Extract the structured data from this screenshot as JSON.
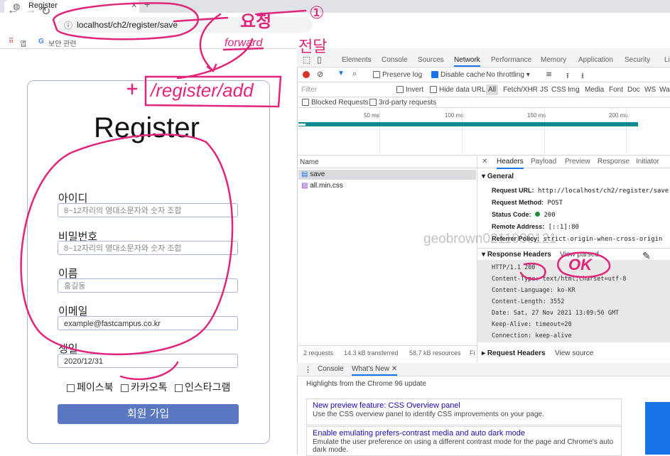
{
  "browser": {
    "tab_title": "Register",
    "tab_icon": "globe-icon",
    "address": "localhost/ch2/register/save",
    "bookmarks": [
      "앱",
      "보안 관련"
    ]
  },
  "form": {
    "title": "Register",
    "fields": [
      {
        "label": "아이디",
        "placeholder": "8~12자리의 영대소문자와 숫자 조합"
      },
      {
        "label": "비밀번호",
        "placeholder": "8~12자리의 영대소문자와 숫자 조합"
      },
      {
        "label": "이름",
        "placeholder": "홍길동"
      },
      {
        "label": "이메일",
        "value": "example@fastcampus.co.kr"
      },
      {
        "label": "생일",
        "value": "2020/12/31"
      }
    ],
    "checkboxes": [
      "페이스북",
      "카카오톡",
      "인스타그램"
    ],
    "submit_label": "회원 가입",
    "accent_color": "#5a78c2"
  },
  "devtools": {
    "tabs": [
      "Elements",
      "Console",
      "Sources",
      "Network",
      "Performance",
      "Memory",
      "Application",
      "Security",
      "Li"
    ],
    "active_tab": "Network",
    "toolbar": {
      "preserve_log": "Preserve log",
      "disable_cache": "Disable cache",
      "throttling": "No throttling"
    },
    "filter": {
      "placeholder": "Filter",
      "invert": "Invert",
      "hide_data_urls": "Hide data URLs",
      "types": [
        "All",
        "Fetch/XHR",
        "JS",
        "CSS",
        "Img",
        "Media",
        "Font",
        "Doc",
        "WS",
        "Was"
      ],
      "blocked": "Blocked Requests",
      "third_party": "3rd-party requests"
    },
    "timeline_ticks": [
      "50 ms",
      "100 ms",
      "150 ms",
      "200 ms"
    ],
    "name_header": "Name",
    "requests": [
      {
        "name": "save",
        "selected": true
      },
      {
        "name": "all.min.css",
        "selected": false
      }
    ],
    "detail_tabs": [
      "Headers",
      "Payload",
      "Preview",
      "Response",
      "Initiator"
    ],
    "general": {
      "title": "General",
      "rows": [
        {
          "key": "Request URL:",
          "value": "http://localhost/ch2/register/save"
        },
        {
          "key": "Request Method:",
          "value": "POST"
        },
        {
          "key": "Status Code:",
          "value": "200"
        },
        {
          "key": "Remote Address:",
          "value": "[::1]:80"
        },
        {
          "key": "Referrer Policy:",
          "value": "strict-origin-when-cross-origin"
        }
      ]
    },
    "response_headers": {
      "title": "Response Headers",
      "view_link": "View parsed",
      "lines": [
        "HTTP/1.1 200",
        "Content-Type: text/html;charset=utf-8",
        "Content-Language: ko-KR",
        "Content-Length: 3552",
        "Date: Sat, 27 Nov 2021 13:09:56 GMT",
        "Keep-Alive: timeout=20",
        "Connection: keep-alive"
      ]
    },
    "request_headers": {
      "title": "Request Headers",
      "view_link": "View source"
    },
    "summary": [
      "2 requests",
      "14.3 kB transferred",
      "58.7 kB resources",
      "Fi"
    ],
    "drawer": {
      "tabs": [
        "Console",
        "What's New"
      ],
      "active": "What's New",
      "highlight": "Highlights from the Chrome 96 update",
      "features": [
        {
          "title": "New preview feature: CSS Overview panel",
          "desc": "Use the CSS overview panel to identify CSS improvements on your page."
        },
        {
          "title": "Enable emulating prefers-contrast media and auto dark mode",
          "desc": "Emulate the user preference on using a different contrast mode for the page and Chrome's auto dark mode."
        }
      ]
    },
    "status_dot_color": "#1e8e3e"
  },
  "annotations": {
    "circle_1": "①",
    "yocheong": "요청",
    "forward": "forward",
    "jeondal": "전달",
    "register_add": "/register/add",
    "ok": "OK",
    "ink_color": "#e0257a"
  },
  "watermark": "geobrown0211030121"
}
